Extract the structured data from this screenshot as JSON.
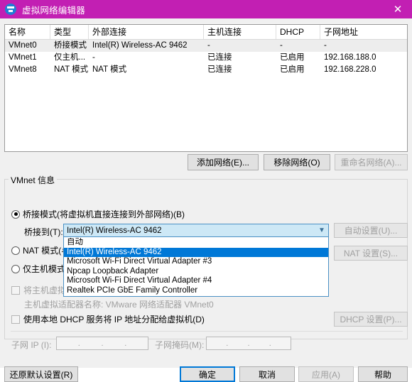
{
  "window": {
    "title": "虚拟网络编辑器",
    "icon": "vmware-logo-icon",
    "close_label": "✕",
    "titlebar_color": "#c21fb3"
  },
  "network_list": {
    "columns": [
      "名称",
      "类型",
      "外部连接",
      "主机连接",
      "DHCP",
      "子网地址"
    ],
    "rows": [
      {
        "name": "VMnet0",
        "type": "桥接模式",
        "external": "Intel(R) Wireless-AC 9462",
        "host": "-",
        "dhcp": "-",
        "subnet": "-",
        "selected": true
      },
      {
        "name": "VMnet1",
        "type": "仅主机...",
        "external": "-",
        "host": "已连接",
        "dhcp": "已启用",
        "subnet": "192.168.188.0",
        "selected": false
      },
      {
        "name": "VMnet8",
        "type": "NAT 模式",
        "external": "NAT 模式",
        "host": "已连接",
        "dhcp": "已启用",
        "subnet": "192.168.228.0",
        "selected": false
      }
    ]
  },
  "list_actions": {
    "add": "添加网络(E)...",
    "remove": "移除网络(O)",
    "rename": "重命名网络(A)..."
  },
  "vmnet_info": {
    "group_title": "VMnet 信息",
    "bridged_radio": "桥接模式(将虚拟机直接连接到外部网络)(B)",
    "nat_radio": "NAT 模式(与",
    "hostonly_radio": "仅主机模式",
    "bridge_to_label": "桥接到(T):",
    "bridge_to_value": "Intel(R) Wireless-AC 9462",
    "dropdown_options": [
      "自动",
      "Intel(R) Wireless-AC 9462",
      "Microsoft Wi-Fi Direct Virtual Adapter #3",
      "Npcap Loopback Adapter",
      "Microsoft Wi-Fi Direct Virtual Adapter #4",
      "Realtek PCIe GbE Family Controller"
    ],
    "dropdown_selected_index": 1,
    "auto_settings_button": "自动设置(U)...",
    "nat_settings_button": "NAT 设置(S)...",
    "host_adapter_checkbox": "将主机虚拟",
    "host_adapter_name": "主机虚拟适配器名称: VMware 网络适配器 VMnet0",
    "dhcp_checkbox": "使用本地 DHCP 服务将 IP 地址分配给虚拟机(D)",
    "dhcp_settings_button": "DHCP 设置(P)...",
    "subnet_ip_label": "子网 IP (I):",
    "subnet_ip_value": "",
    "subnet_mask_label": "子网掩码(M):",
    "subnet_mask_value": "",
    "ip_dot": "."
  },
  "footer": {
    "restore": "还原默认设置(R)",
    "ok": "确定",
    "cancel": "取消",
    "apply": "应用(A)",
    "help": "帮助"
  },
  "colors": {
    "accent": "#0078d7",
    "titlebar": "#c21fb3",
    "combo_fill": "#cde8f6"
  }
}
